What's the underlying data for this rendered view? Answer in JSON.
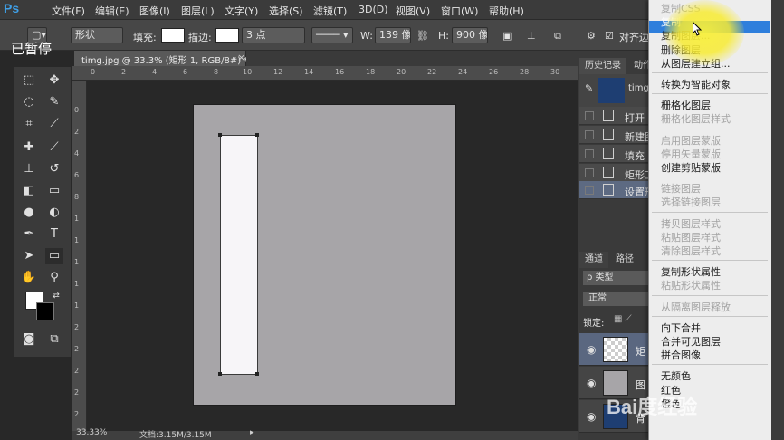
{
  "app": {
    "logo": "Ps",
    "paused_overlay": "已暂停"
  },
  "menubar": {
    "items": [
      "文件(F)",
      "编辑(E)",
      "图像(I)",
      "图层(L)",
      "文字(Y)",
      "选择(S)",
      "滤镜(T)",
      "3D(D)",
      "视图(V)",
      "窗口(W)",
      "帮助(H)"
    ]
  },
  "options": {
    "mode": "形状",
    "fill_label": "填充:",
    "stroke_label": "描边:",
    "stroke_width": "3 点",
    "w_label": "W:",
    "w_value": "139 像",
    "h_label": "H:",
    "h_value": "900 像",
    "align_edges": "对齐边"
  },
  "document": {
    "tab_title": "timg.jpg @ 33.3% (矩形 1, RGB/8#) *",
    "close": "×",
    "zoom": "33.33%",
    "doc_size": "文档:3.15M/3.15M"
  },
  "rulers": {
    "top": [
      "0",
      "2",
      "4",
      "6",
      "8",
      "10",
      "12",
      "14",
      "16",
      "18",
      "20",
      "22",
      "24",
      "26",
      "28",
      "30"
    ],
    "left": [
      "0",
      "2",
      "4",
      "6",
      "8",
      "1",
      "1",
      "1",
      "1",
      "1",
      "2",
      "2",
      "2",
      "2",
      "2",
      "3"
    ]
  },
  "history_panel": {
    "tabs": [
      "历史记录",
      "动作"
    ],
    "snapshot": "timg.",
    "items": [
      "打开",
      "新建图",
      "填充",
      "矩形工",
      "设置形"
    ],
    "selected_index": 4
  },
  "layers_panel": {
    "tabs": [
      "通道",
      "路径"
    ],
    "filter_label": "ρ 类型",
    "blend_mode": "正常",
    "lock_label": "锁定:",
    "layers": [
      "矩",
      "图",
      "背"
    ]
  },
  "context_menu": {
    "items": [
      {
        "label": "复制CSS",
        "disabled": true
      },
      {
        "label": "复制",
        "disabled": false,
        "highlighted": true
      },
      {
        "label": "复制图层...",
        "disabled": false
      },
      {
        "label": "删除图层",
        "disabled": false
      },
      {
        "label": "从图层建立组...",
        "disabled": false
      },
      {
        "sep": true
      },
      {
        "label": "转换为智能对象",
        "disabled": false
      },
      {
        "sep": true
      },
      {
        "label": "栅格化图层",
        "disabled": false
      },
      {
        "label": "栅格化图层样式",
        "disabled": true
      },
      {
        "sep": true
      },
      {
        "label": "启用图层蒙版",
        "disabled": true
      },
      {
        "label": "停用矢量蒙版",
        "disabled": true
      },
      {
        "label": "创建剪贴蒙版",
        "disabled": false
      },
      {
        "sep": true
      },
      {
        "label": "链接图层",
        "disabled": true
      },
      {
        "label": "选择链接图层",
        "disabled": true
      },
      {
        "sep": true
      },
      {
        "label": "拷贝图层样式",
        "disabled": true
      },
      {
        "label": "粘贴图层样式",
        "disabled": true
      },
      {
        "label": "清除图层样式",
        "disabled": true
      },
      {
        "sep": true
      },
      {
        "label": "复制形状属性",
        "disabled": false
      },
      {
        "label": "粘贴形状属性",
        "disabled": true
      },
      {
        "sep": true
      },
      {
        "label": "从隔离图层释放",
        "disabled": true
      },
      {
        "sep": true
      },
      {
        "label": "向下合并",
        "disabled": false
      },
      {
        "label": "合并可见图层",
        "disabled": false
      },
      {
        "label": "拼合图像",
        "disabled": false
      },
      {
        "sep": true
      },
      {
        "label": "无颜色",
        "disabled": false
      },
      {
        "label": "红色",
        "disabled": false
      },
      {
        "label": "橙色",
        "disabled": false
      }
    ]
  },
  "watermark": "Bai度经验",
  "colors": {
    "canvas": "#a7a5a8",
    "shape_fill": "#f7f5f8",
    "menu_highlight": "#2f7fdc",
    "history_selected": "#5d6a82"
  }
}
